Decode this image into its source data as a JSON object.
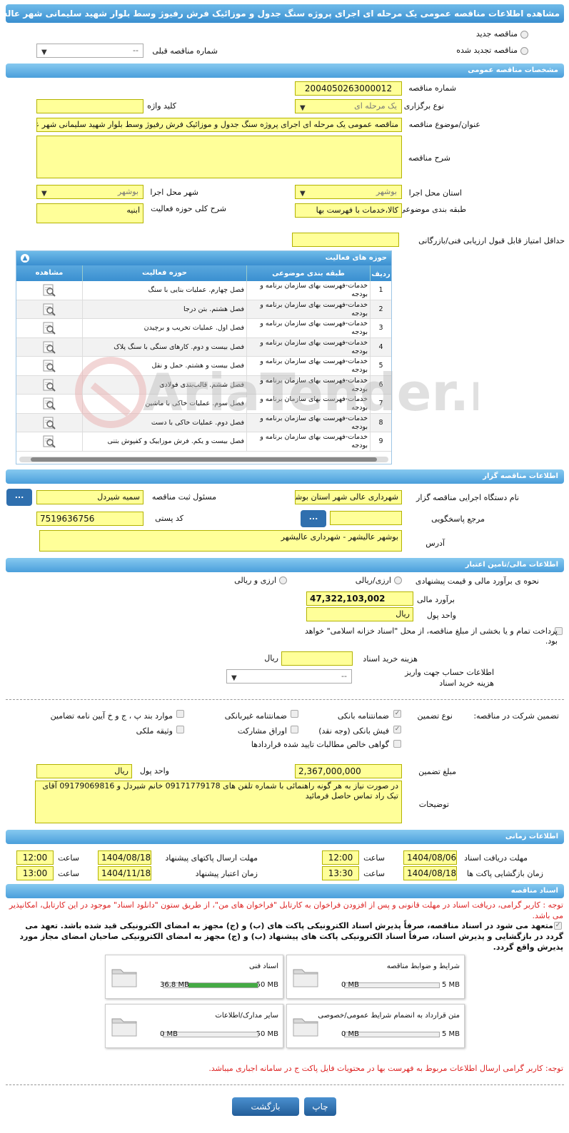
{
  "title": "مشاهده اطلاعات مناقصه عمومی یک مرحله ای اجرای پروژه سنگ جدول و موزائیک فرش رفیوژ وسط بلوار شهید سلیمانی شهر عالشهر",
  "tender_type": {
    "new": "مناقصه جدید",
    "renewed": "مناقصه تجدید شده",
    "prev_label": "شماره مناقصه قبلی",
    "prev_value": "--"
  },
  "general": {
    "section": "مشخصات مناقصه عمومی",
    "number_label": "شماره مناقصه",
    "number": "2004050263000012",
    "type_label": "نوع برگزاری",
    "type": "یک مرحله ای",
    "keyword_label": "کلید واژه",
    "subject_label": "عنوان/موضوع مناقصه",
    "subject": "مناقصه عمومی یک مرحله ای اجرای پروژه سنگ جدول و موزائیک فرش رفیوژ وسط بلوار شهید سلیمانی شهر عالشهر",
    "desc_label": "شرح مناقصه",
    "province_label": "استان محل اجرا",
    "province": "بوشهر",
    "city_label": "شهر محل اجرا",
    "city": "بوشهر",
    "category_label": "طبقه بندی موضوعی",
    "category": "کالا،خدمات با فهرست بها",
    "activity_label": "شرح کلی حوزه فعالیت",
    "activity": "ابنیه",
    "min_score_label": "حداقل امتیاز قابل قبول ارزیابی فنی/بازرگانی"
  },
  "activities": {
    "title": "حوزه های فعالیت",
    "cols": [
      "ردیف",
      "طبقه بندی موضوعی",
      "حوزه فعالیت",
      "مشاهده"
    ],
    "rows": [
      [
        "1",
        "خدمات-فهرست بهای سازمان برنامه و بودجه",
        "فصل چهارم. عملیات بنایی با سنگ"
      ],
      [
        "2",
        "خدمات-فهرست بهای سازمان برنامه و بودجه",
        "فصل هشتم. بتن درجا"
      ],
      [
        "3",
        "خدمات-فهرست بهای سازمان برنامه و بودجه",
        "فصل اول. عملیات تخریب و برچیدن"
      ],
      [
        "4",
        "خدمات-فهرست بهای سازمان برنامه و بودجه",
        "فصل بیست و دوم. کارهای سنگی با سنگ پلاک"
      ],
      [
        "5",
        "خدمات-فهرست بهای سازمان برنامه و بودجه",
        "فصل بیست و هشتم. حمل و نقل"
      ],
      [
        "6",
        "خدمات-فهرست بهای سازمان برنامه و بودجه",
        "فصل ششم. قالب‌بندی فولادی"
      ],
      [
        "7",
        "خدمات-فهرست بهای سازمان برنامه و بودجه",
        "فصل سوم. عملیات خاکی با ماشین"
      ],
      [
        "8",
        "خدمات-فهرست بهای سازمان برنامه و بودجه",
        "فصل دوم. عملیات خاکی با دست"
      ],
      [
        "9",
        "خدمات-فهرست بهای سازمان برنامه و بودجه",
        "فصل بیست و یکم. فرش موزاییک و کفپوش بتنی"
      ]
    ]
  },
  "organizer": {
    "section": "اطلاعات مناقصه گزار",
    "org_label": "نام دستگاه اجرایی مناقصه گزار",
    "org": "شهرداری عالی شهر استان بوشهر",
    "officer_label": "مسئول ثبت مناقصه",
    "officer": "سمیه شیردل",
    "ref_label": "مرجع پاسخگویی",
    "postal_label": "کد پستی",
    "postal": "7519636756",
    "address_label": "آدرس",
    "address": "بوشهر عالیشهر - شهرداری عالیشهر",
    "btn": "..."
  },
  "finance": {
    "section": "اطلاعات مالی/تامین اعتبار",
    "method_label": "نحوه ی برآورد مالی و قیمت پیشنهادی",
    "opt1": "ارزی/ریالی",
    "opt2": "ارزی و ریالی",
    "estimate_label": "برآورد مالی",
    "estimate": "47,322,103,002",
    "currency_label": "واحد پول",
    "currency": "ریال",
    "treasury": "پرداخت تمام و یا بخشی از مبلغ مناقصه، از محل \"اسناد خزانه اسلامی\" خواهد بود.",
    "doc_cost_label": "هزینه خرید اسناد",
    "doc_cost_unit": "ریال",
    "account_label": "اطلاعات حساب جهت واریز هزینه خرید اسناد",
    "account": "--"
  },
  "guarantee": {
    "type_label": "تضمین شرکت در مناقصه:",
    "kind_label": "نوع تضمین",
    "items": [
      "ضمانتنامه بانکی",
      "ضمانتنامه غیربانکی",
      "موارد بند پ ، ج و خ آیین نامه تضامین",
      "فیش بانکی (وجه نقد)",
      "اوراق مشارکت",
      "وثیقه ملکی",
      "گواهی خالص مطالبات تایید شده قراردادها"
    ],
    "amount_label": "مبلغ تضمین",
    "amount": "2,367,000,000",
    "currency_label": "واحد پول",
    "currency": "ریال",
    "notes_label": "توضیحات",
    "notes": "در صورت نیاز به هر گونه راهنمائی با شماره تلفن های 09171779178 خانم شیردل و 09179069816 آقای تیک راد تماس حاصل فرمائید"
  },
  "timing": {
    "section": "اطلاعات زمانی",
    "receive_label": "مهلت دریافت اسناد",
    "receive": "1404/08/06",
    "time_label": "ساعت",
    "receive_time": "12:00",
    "send_label": "مهلت ارسال پاکتهای پیشنهاد",
    "send": "1404/08/18",
    "send_time": "12:00",
    "open_label": "زمان بازگشایی پاکت ها",
    "open": "1404/08/18",
    "open_time": "13:30",
    "validity_label": "زمان اعتبار پیشنهاد",
    "validity": "1404/11/18",
    "validity_time": "13:00"
  },
  "docs": {
    "section": "اسناد مناقصه",
    "note1": "توجه : کاربر گرامی، دریافت اسناد در مهلت قانونی و پس از افزودن فراخوان به کارتابل \"فراخوان های من\"، از طریق ستون \"دانلود اسناد\" موجود در این کارتابل، امکانپذیر می باشد.",
    "commit": "متعهد می شود در اسناد مناقصه، صرفاً پذیرش اسناد الکترونیکی پاکت های (ب) و (ج) مجهز به امضای الکترونیکی قید شده باشد. تعهد می گردد در بازگشایی و پذیرش اسناد، صرفاً اسناد الکترونیکی پاکت های پیشنهاد (ب) و (ج) مجهز به امضای الکترونیکی صاحبان امضای مجاز مورد پذیرش واقع گردد.",
    "cards": [
      {
        "name": "شرایط و ضوابط مناقصه",
        "used": "0 MB",
        "max": "5 MB",
        "fill": 0
      },
      {
        "name": "اسناد فنی",
        "used": "36.8 MB",
        "max": "50 MB",
        "fill": 0.736
      },
      {
        "name": "متن قرارداد به انضمام شرایط عمومی/خصوصی",
        "used": "0 MB",
        "max": "5 MB",
        "fill": 0
      },
      {
        "name": "سایر مدارک/اطلاعات",
        "used": "0 MB",
        "max": "50 MB",
        "fill": 0
      }
    ],
    "note2": "توجه: کاربر گرامی ارسال اطلاعات مربوط به فهرست بها در محتویات فایل پاکت ج در سامانه اجباری میباشد."
  },
  "buttons": {
    "print": "چاپ",
    "back": "بازگشت"
  },
  "watermark": "AriaTender.neT"
}
